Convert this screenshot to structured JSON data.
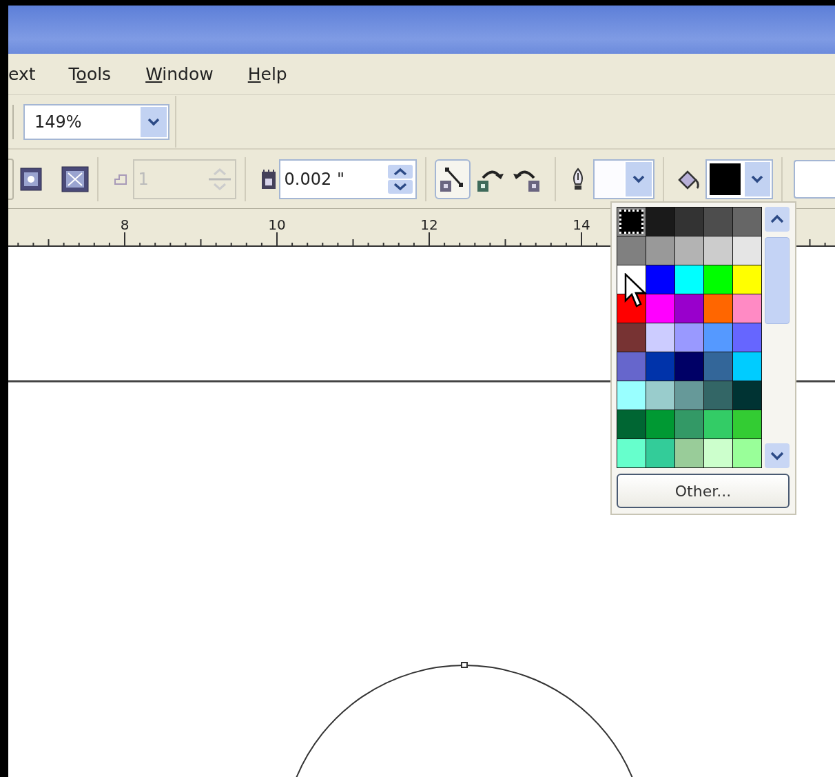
{
  "menu": [
    {
      "before": "ext"
    },
    {
      "before": "T",
      "key": "o",
      "after": "ols"
    },
    {
      "key": "W",
      "after": "indow"
    },
    {
      "key": "H",
      "after": "elp"
    }
  ],
  "zoom": {
    "value": "149%"
  },
  "outline_count": {
    "value": "1",
    "disabled": true
  },
  "nudge": {
    "value": "0.002 \""
  },
  "convert_buttons": [
    {
      "pressed": true
    },
    {
      "pressed": false
    },
    {
      "pressed": false
    }
  ],
  "fill_swatch": {
    "color": "#000000"
  },
  "ruler": {
    "labels": [
      "8",
      "10",
      "12",
      "14"
    ]
  },
  "palette": {
    "swatches": [
      {
        "color": "#000000",
        "selected": true
      },
      {
        "color": "#1a1a1a",
        "selected": false
      },
      {
        "color": "#333333",
        "selected": false
      },
      {
        "color": "#4d4d4d",
        "selected": false
      },
      {
        "color": "#666666",
        "selected": false
      },
      {
        "color": "#808080",
        "selected": false
      },
      {
        "color": "#999999",
        "selected": false
      },
      {
        "color": "#b3b3b3",
        "selected": false
      },
      {
        "color": "#cccccc",
        "selected": false
      },
      {
        "color": "#e5e5e5",
        "selected": false
      },
      {
        "color": "#ffffff",
        "selected": false
      },
      {
        "color": "#0000ff",
        "selected": false
      },
      {
        "color": "#00ffff",
        "selected": false
      },
      {
        "color": "#00ff00",
        "selected": false
      },
      {
        "color": "#ffff00",
        "selected": false
      },
      {
        "color": "#ff0000",
        "selected": false
      },
      {
        "color": "#ff00ff",
        "selected": false
      },
      {
        "color": "#9900cc",
        "selected": false
      },
      {
        "color": "#ff6600",
        "selected": false
      },
      {
        "color": "#ff8ac4",
        "selected": false
      },
      {
        "color": "#773333",
        "selected": false
      },
      {
        "color": "#ccccff",
        "selected": false
      },
      {
        "color": "#9999ff",
        "selected": false
      },
      {
        "color": "#5599ff",
        "selected": false
      },
      {
        "color": "#6666ff",
        "selected": false
      },
      {
        "color": "#6666cc",
        "selected": false
      },
      {
        "color": "#0033aa",
        "selected": false
      },
      {
        "color": "#000066",
        "selected": false
      },
      {
        "color": "#336699",
        "selected": false
      },
      {
        "color": "#00ccff",
        "selected": false
      },
      {
        "color": "#99ffff",
        "selected": false
      },
      {
        "color": "#99cccc",
        "selected": false
      },
      {
        "color": "#669999",
        "selected": false
      },
      {
        "color": "#336666",
        "selected": false
      },
      {
        "color": "#003333",
        "selected": false
      },
      {
        "color": "#006633",
        "selected": false
      },
      {
        "color": "#009933",
        "selected": false
      },
      {
        "color": "#339966",
        "selected": false
      },
      {
        "color": "#33cc66",
        "selected": false
      },
      {
        "color": "#33cc33",
        "selected": false
      },
      {
        "color": "#66ffcc",
        "selected": false
      },
      {
        "color": "#33cc99",
        "selected": false
      },
      {
        "color": "#99cc99",
        "selected": false
      },
      {
        "color": "#ccffcc",
        "selected": false
      },
      {
        "color": "#99ff99",
        "selected": false
      }
    ],
    "other_button": "Other..."
  }
}
